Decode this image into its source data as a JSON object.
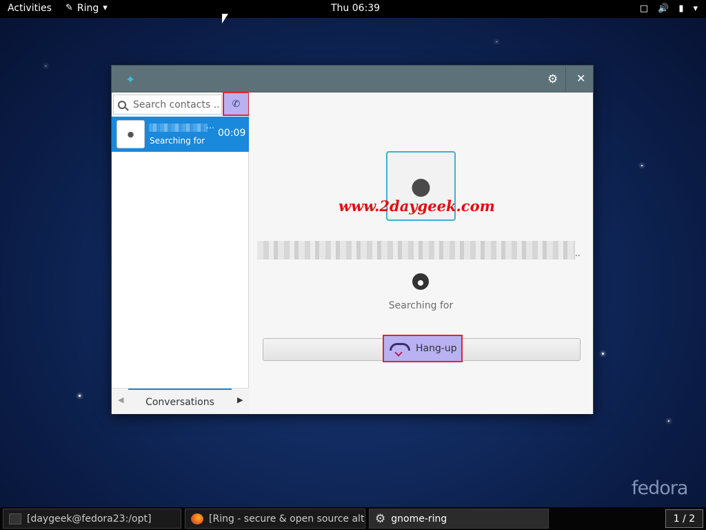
{
  "topbar": {
    "activities": "Activities",
    "app_menu": "Ring",
    "clock": "Thu 06:39",
    "icons": [
      "screen-icon",
      "volume-icon",
      "battery-icon",
      "system-menu-chevron-icon"
    ]
  },
  "window": {
    "search": {
      "placeholder": "Search contacts ..."
    },
    "conversation": {
      "status": "Searching for",
      "duration": "00:09"
    },
    "sidebar_footer": {
      "tab_label": "Conversations"
    },
    "call": {
      "watermark": "www.2daygeek.com",
      "state": "Searching for",
      "hangup_label": "Hang-up"
    },
    "colors": {
      "titlebar": "#5c7178",
      "selection": "#1a88db",
      "highlight_box": "#e02525"
    }
  },
  "desktop": {
    "logo": "fedora"
  },
  "taskbar": {
    "tasks": [
      {
        "label": "[daygeek@fedora23:/opt]"
      },
      {
        "label": "[Ring - secure & open source alter..."
      },
      {
        "label": "gnome-ring"
      }
    ],
    "workspace": "1 / 2"
  }
}
